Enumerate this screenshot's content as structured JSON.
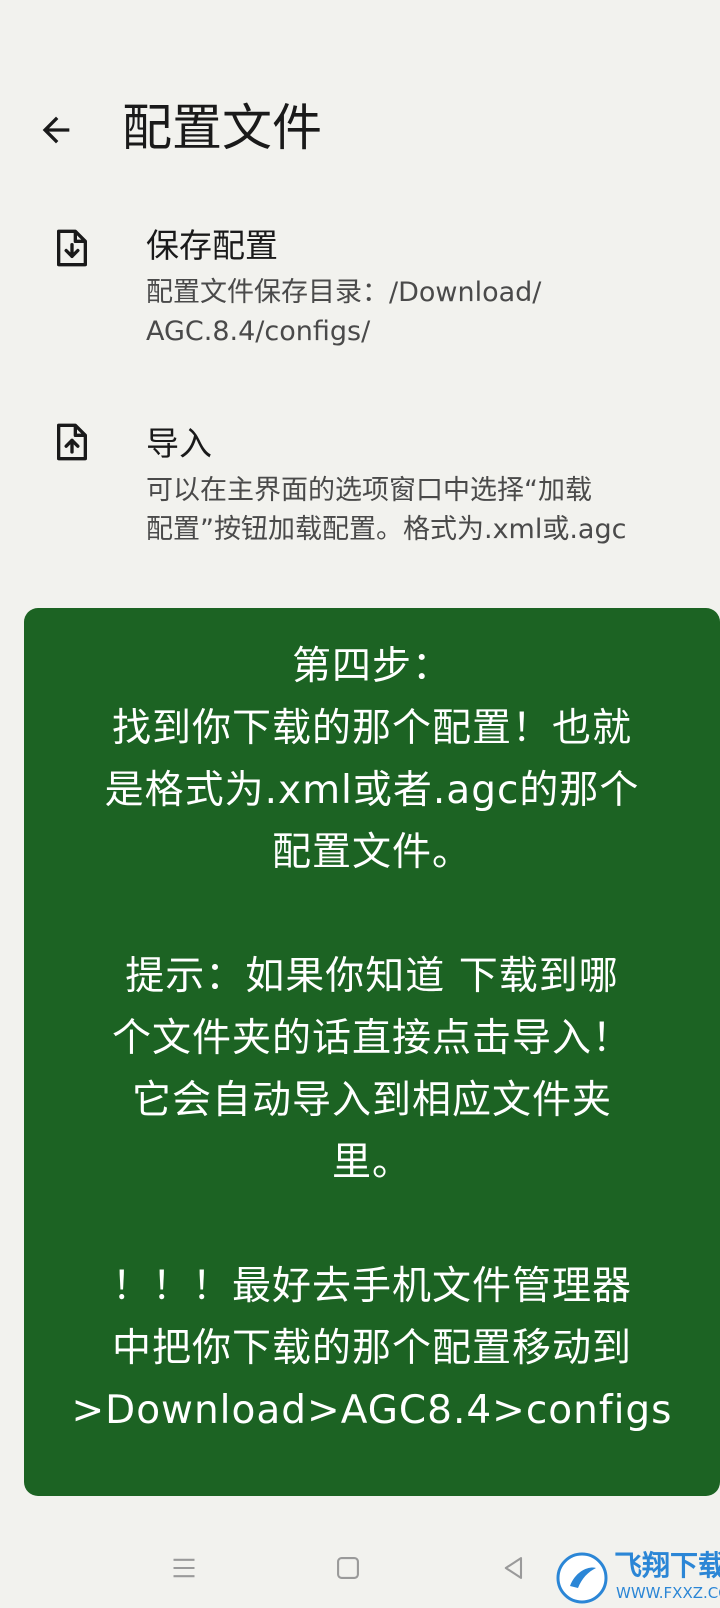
{
  "appbar": {
    "back_icon": "arrow-left-icon",
    "title": "配置文件"
  },
  "preferences": [
    {
      "icon": "file-download-icon",
      "title": "保存配置",
      "summary_lines": [
        "配置文件保存目录：/Download/",
        "AGC.8.4/configs/"
      ]
    },
    {
      "icon": "file-upload-icon",
      "title": "导入",
      "summary_lines": [
        "可以在主界面的选项窗口中选择“加载",
        "配置”按钮加载配置。格式为.xml或.agc"
      ]
    }
  ],
  "overlay": {
    "background": "#1c6323",
    "lines": [
      "第四步：",
      "找到你下载的那个配置！也就",
      "是格式为.xml或者.agc的那个",
      "配置文件。",
      "",
      "提示：如果你知道    下载到哪",
      "个文件夹的话直接点击导入！",
      "它会自动导入到相应文件夹",
      "里。",
      "",
      "！！！最好去手机文件管理器",
      "中把你下载的那个配置移动到",
      ">Download>AGC8.4>configs"
    ]
  },
  "navbar": {
    "menu_icon": "menu-icon",
    "home_icon": "home-square-icon",
    "back_icon": "back-triangle-icon"
  },
  "watermark": {
    "title": "飞翔下载",
    "subtitle": "WWW.FXXZ.COM"
  }
}
